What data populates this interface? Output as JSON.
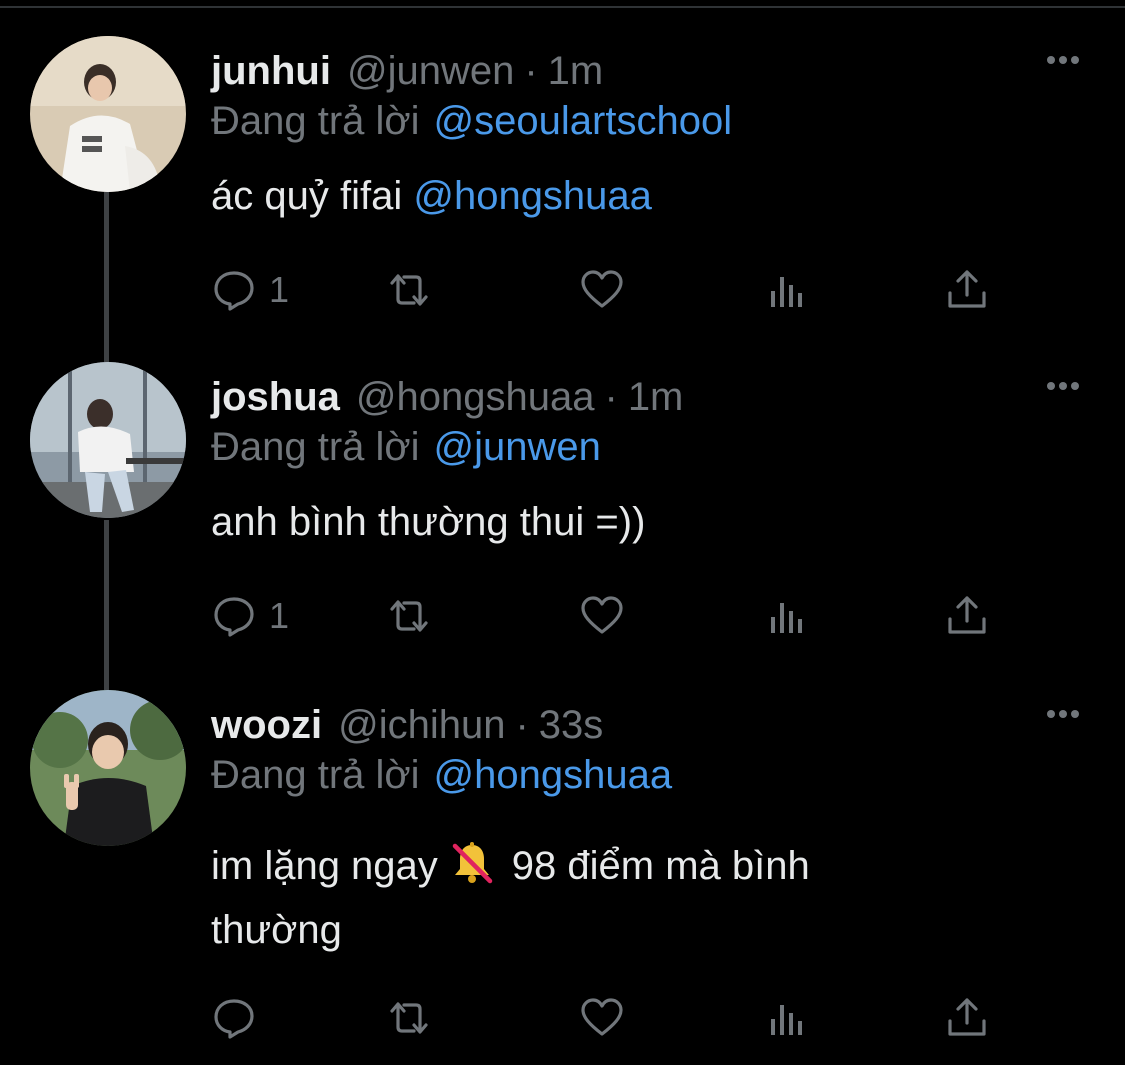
{
  "theme": {
    "background": "#000000",
    "text": "#e7e9ea",
    "muted": "#71767b",
    "link": "#4a99e9",
    "thread_line": "#3e4144"
  },
  "tweets": [
    {
      "name": "junhui",
      "handle": "@junwen",
      "dot": "·",
      "time": "1m",
      "reply_prefix": "Đang trả lời",
      "reply_to": "@seoulartschool",
      "text": "ác quỷ fifai",
      "mention": "@hongshuaa",
      "reply_count": "1",
      "avatar": "profile-photo-person-white-hoodie"
    },
    {
      "name": "joshua",
      "handle": "@hongshuaa",
      "dot": "·",
      "time": "1m",
      "reply_prefix": "Đang trả lời",
      "reply_to": "@junwen",
      "text": "anh bình thường thui =))",
      "reply_count": "1",
      "avatar": "profile-photo-person-sitting-by-window"
    },
    {
      "name": "woozi",
      "handle": "@ichihun",
      "dot": "·",
      "time": "33s",
      "reply_prefix": "Đang trả lời",
      "reply_to": "@hongshuaa",
      "text_line1_a": "im lặng ngay",
      "text_line1_b": "98 điểm mà bình",
      "text_line2": "thường",
      "emoji": "bell-with-slash-icon",
      "reply_count": "",
      "avatar": "profile-photo-person-peace-sign"
    }
  ],
  "action_icons": [
    "reply-icon",
    "retweet-icon",
    "like-icon",
    "views-icon",
    "share-icon"
  ],
  "more_icon": "more-options-icon"
}
